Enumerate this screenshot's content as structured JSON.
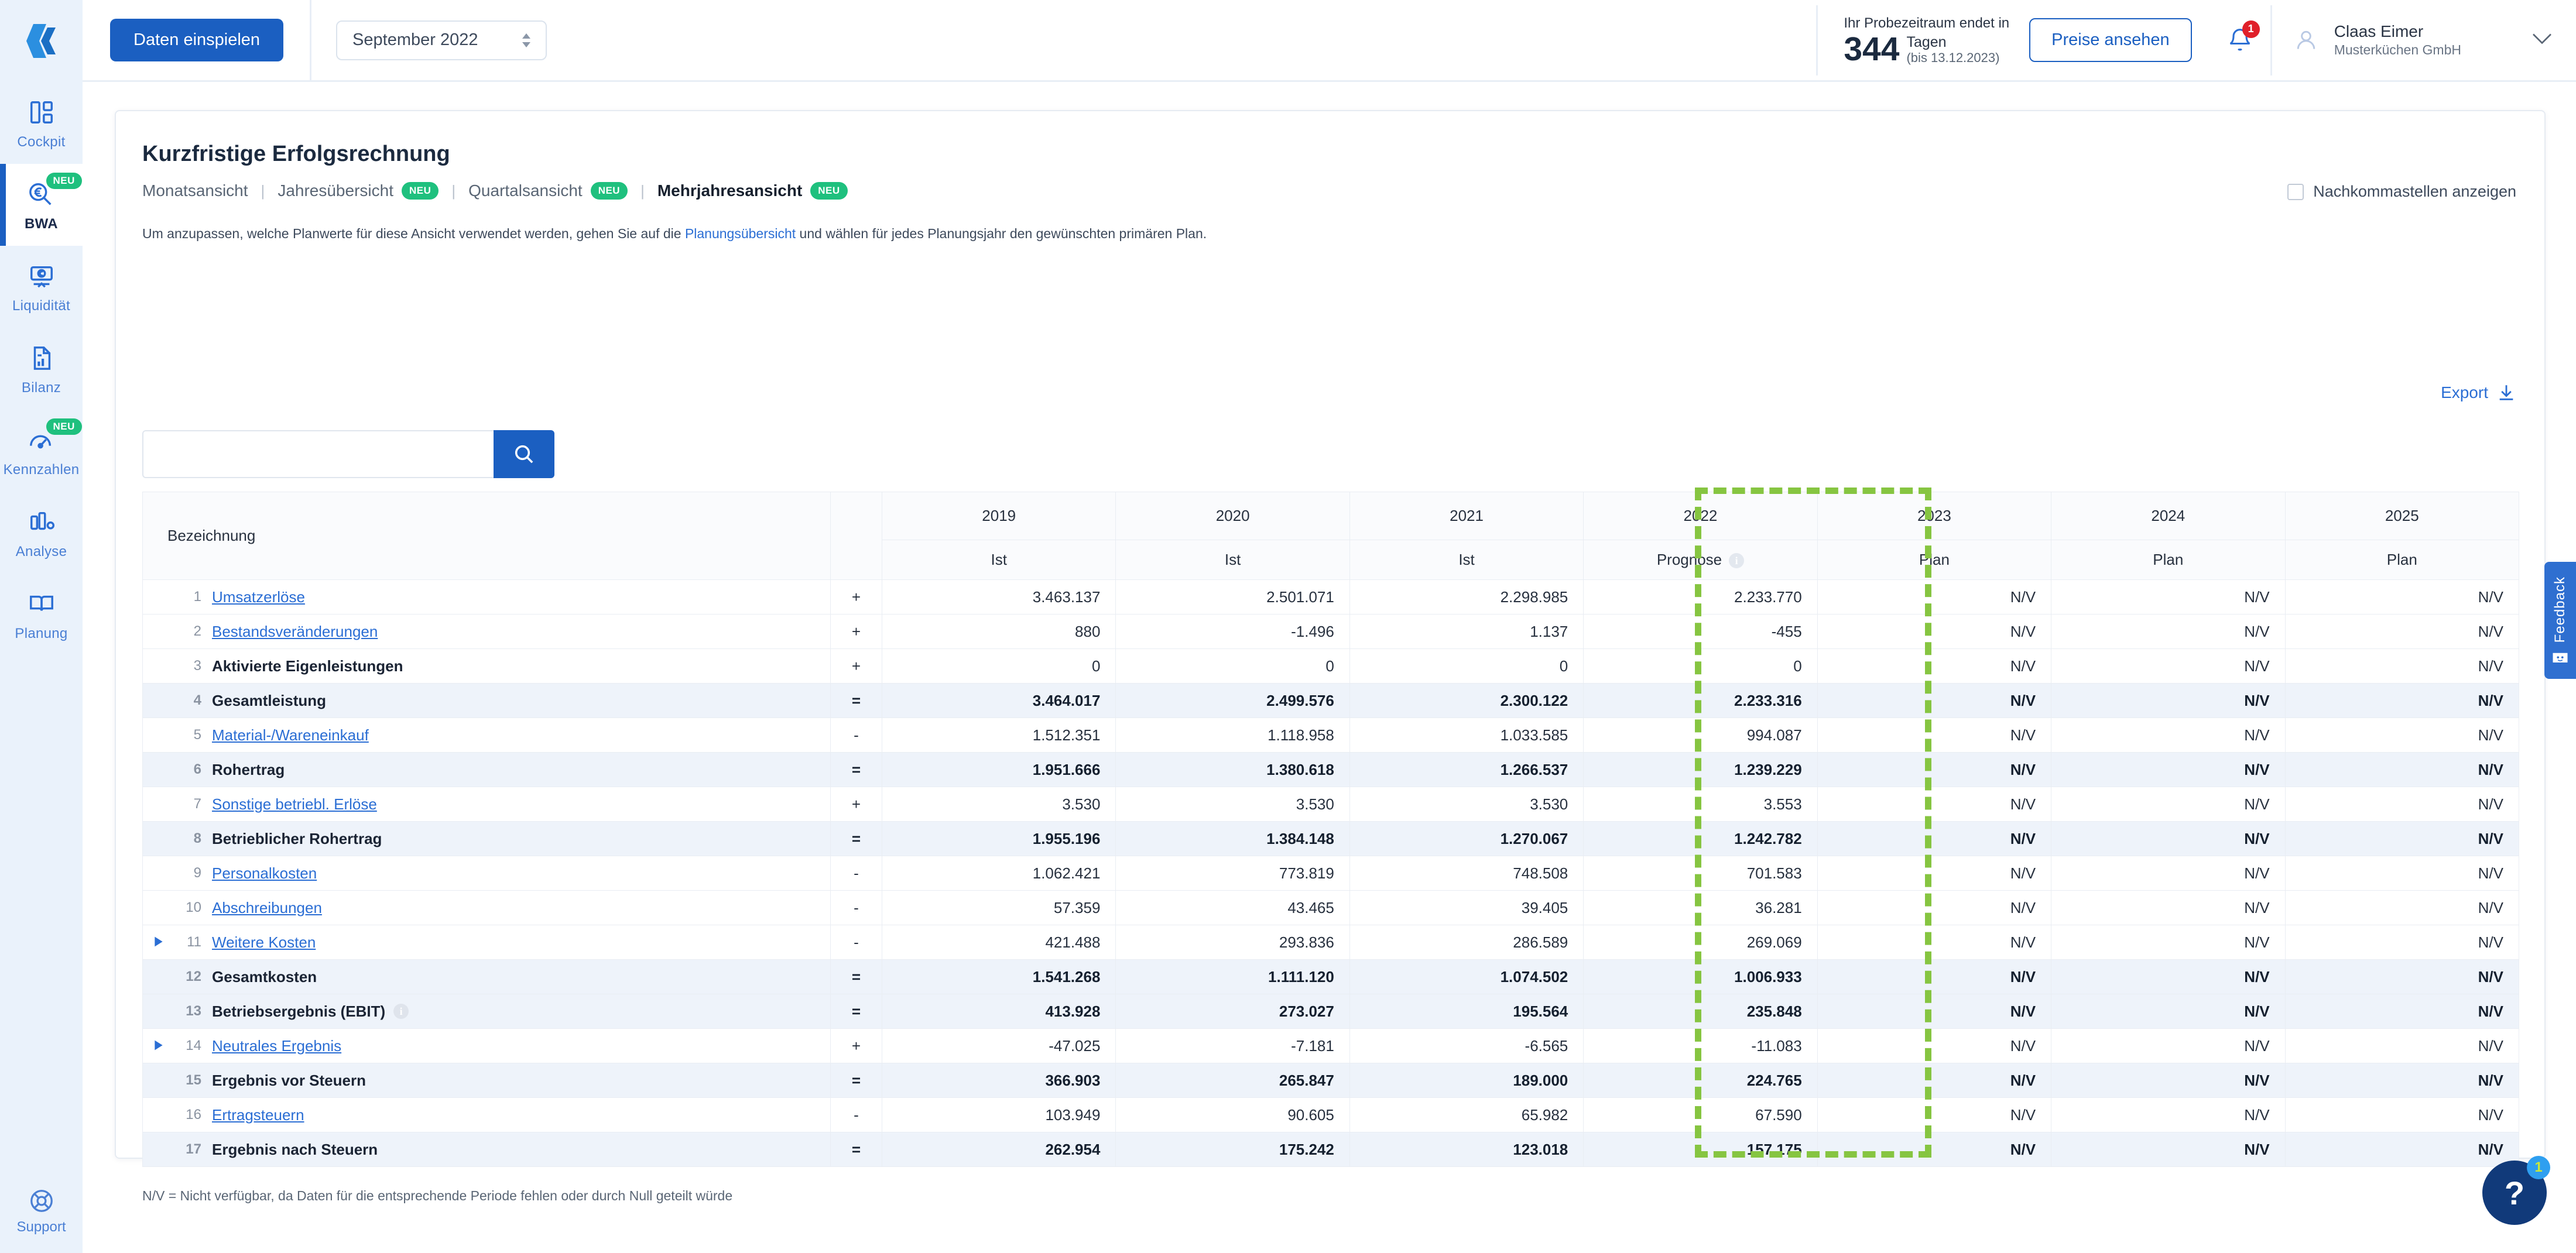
{
  "sidebar": {
    "logo": "agicap-logo",
    "items": [
      {
        "label": "Cockpit",
        "icon": "dashboard-icon",
        "badge": null,
        "active": false
      },
      {
        "label": "BWA",
        "icon": "euro-search-icon",
        "badge": "NEU",
        "active": true
      },
      {
        "label": "Liquidität",
        "icon": "cash-out-icon",
        "badge": null,
        "active": false
      },
      {
        "label": "Bilanz",
        "icon": "document-chart-icon",
        "badge": null,
        "active": false
      },
      {
        "label": "Kennzahlen",
        "icon": "gauge-icon",
        "badge": "NEU",
        "active": false
      },
      {
        "label": "Analyse",
        "icon": "bar-chart-icon",
        "badge": null,
        "active": false
      },
      {
        "label": "Planung",
        "icon": "book-icon",
        "badge": null,
        "active": false
      }
    ],
    "support": {
      "label": "Support",
      "icon": "lifebuoy-icon"
    }
  },
  "topbar": {
    "import_button": "Daten einspielen",
    "month_selector": "September 2022",
    "trial": {
      "line1": "Ihr Probezeitraum endet in",
      "days": "344",
      "days_unit": "Tagen",
      "until": "(bis 13.12.2023)"
    },
    "pricing_button": "Preise ansehen",
    "notification_count": "1",
    "user": {
      "name": "Claas Eimer",
      "org": "Musterküchen GmbH"
    }
  },
  "page": {
    "title": "Kurzfristige Erfolgsrechnung",
    "tabs": [
      {
        "label": "Monatsansicht",
        "badge": null,
        "active": false
      },
      {
        "label": "Jahresübersicht",
        "badge": "NEU",
        "active": false
      },
      {
        "label": "Quartalsansicht",
        "badge": "NEU",
        "active": false
      },
      {
        "label": "Mehrjahresansicht",
        "badge": "NEU",
        "active": true
      }
    ],
    "decimals_checkbox_label": "Nachkommastellen anzeigen",
    "hint_before": "Um anzupassen, welche Planwerte für diese Ansicht verwendet werden, gehen Sie auf die ",
    "hint_link": "Planungsübersicht",
    "hint_after": " und wählen für jedes Planungsjahr den gewünschten primären Plan.",
    "search_placeholder": "",
    "search_value": "",
    "export_label": "Export",
    "footnote": "N/V = Nicht verfügbar, da Daten für die entsprechende Periode fehlen oder durch Null geteilt würde"
  },
  "table": {
    "name_header": "Bezeichnung",
    "columns": [
      {
        "year": "2019",
        "sub": "Ist",
        "highlighted": false,
        "info": false
      },
      {
        "year": "2020",
        "sub": "Ist",
        "highlighted": false,
        "info": false
      },
      {
        "year": "2021",
        "sub": "Ist",
        "highlighted": false,
        "info": false
      },
      {
        "year": "2022",
        "sub": "Prognose",
        "highlighted": true,
        "info": true
      },
      {
        "year": "2023",
        "sub": "Plan",
        "highlighted": false,
        "info": false
      },
      {
        "year": "2024",
        "sub": "Plan",
        "highlighted": false,
        "info": false
      },
      {
        "year": "2025",
        "sub": "Plan",
        "highlighted": false,
        "info": false
      }
    ],
    "rows": [
      {
        "num": "1",
        "label": "Umsatzerlöse",
        "link": true,
        "sum": false,
        "expand": false,
        "info": false,
        "sign": "+",
        "values": [
          "3.463.137",
          "2.501.071",
          "2.298.985",
          "2.233.770",
          "N/V",
          "N/V",
          "N/V"
        ]
      },
      {
        "num": "2",
        "label": "Bestandsveränderungen",
        "link": true,
        "sum": false,
        "expand": false,
        "info": false,
        "sign": "+",
        "values": [
          "880",
          "-1.496",
          "1.137",
          "-455",
          "N/V",
          "N/V",
          "N/V"
        ]
      },
      {
        "num": "3",
        "label": "Aktivierte Eigenleistungen",
        "link": false,
        "sum": false,
        "expand": false,
        "info": false,
        "sign": "+",
        "values": [
          "0",
          "0",
          "0",
          "0",
          "N/V",
          "N/V",
          "N/V"
        ]
      },
      {
        "num": "4",
        "label": "Gesamtleistung",
        "link": false,
        "sum": true,
        "expand": false,
        "info": false,
        "sign": "=",
        "values": [
          "3.464.017",
          "2.499.576",
          "2.300.122",
          "2.233.316",
          "N/V",
          "N/V",
          "N/V"
        ]
      },
      {
        "num": "5",
        "label": "Material-/Wareneinkauf",
        "link": true,
        "sum": false,
        "expand": false,
        "info": false,
        "sign": "-",
        "values": [
          "1.512.351",
          "1.118.958",
          "1.033.585",
          "994.087",
          "N/V",
          "N/V",
          "N/V"
        ]
      },
      {
        "num": "6",
        "label": "Rohertrag",
        "link": false,
        "sum": true,
        "expand": false,
        "info": false,
        "sign": "=",
        "values": [
          "1.951.666",
          "1.380.618",
          "1.266.537",
          "1.239.229",
          "N/V",
          "N/V",
          "N/V"
        ]
      },
      {
        "num": "7",
        "label": "Sonstige betriebl. Erlöse",
        "link": true,
        "sum": false,
        "expand": false,
        "info": false,
        "sign": "+",
        "values": [
          "3.530",
          "3.530",
          "3.530",
          "3.553",
          "N/V",
          "N/V",
          "N/V"
        ]
      },
      {
        "num": "8",
        "label": "Betrieblicher Rohertrag",
        "link": false,
        "sum": true,
        "expand": false,
        "info": false,
        "sign": "=",
        "values": [
          "1.955.196",
          "1.384.148",
          "1.270.067",
          "1.242.782",
          "N/V",
          "N/V",
          "N/V"
        ]
      },
      {
        "num": "9",
        "label": "Personalkosten",
        "link": true,
        "sum": false,
        "expand": false,
        "info": false,
        "sign": "-",
        "values": [
          "1.062.421",
          "773.819",
          "748.508",
          "701.583",
          "N/V",
          "N/V",
          "N/V"
        ]
      },
      {
        "num": "10",
        "label": "Abschreibungen",
        "link": true,
        "sum": false,
        "expand": false,
        "info": false,
        "sign": "-",
        "values": [
          "57.359",
          "43.465",
          "39.405",
          "36.281",
          "N/V",
          "N/V",
          "N/V"
        ]
      },
      {
        "num": "11",
        "label": "Weitere Kosten",
        "link": true,
        "sum": false,
        "expand": true,
        "info": false,
        "sign": "-",
        "values": [
          "421.488",
          "293.836",
          "286.589",
          "269.069",
          "N/V",
          "N/V",
          "N/V"
        ]
      },
      {
        "num": "12",
        "label": "Gesamtkosten",
        "link": false,
        "sum": true,
        "expand": false,
        "info": false,
        "sign": "=",
        "values": [
          "1.541.268",
          "1.111.120",
          "1.074.502",
          "1.006.933",
          "N/V",
          "N/V",
          "N/V"
        ]
      },
      {
        "num": "13",
        "label": "Betriebsergebnis (EBIT)",
        "link": false,
        "sum": true,
        "expand": false,
        "info": true,
        "sign": "=",
        "values": [
          "413.928",
          "273.027",
          "195.564",
          "235.848",
          "N/V",
          "N/V",
          "N/V"
        ]
      },
      {
        "num": "14",
        "label": "Neutrales Ergebnis",
        "link": true,
        "sum": false,
        "expand": true,
        "info": false,
        "sign": "+",
        "values": [
          "-47.025",
          "-7.181",
          "-6.565",
          "-11.083",
          "N/V",
          "N/V",
          "N/V"
        ]
      },
      {
        "num": "15",
        "label": "Ergebnis vor Steuern",
        "link": false,
        "sum": true,
        "expand": false,
        "info": false,
        "sign": "=",
        "values": [
          "366.903",
          "265.847",
          "189.000",
          "224.765",
          "N/V",
          "N/V",
          "N/V"
        ]
      },
      {
        "num": "16",
        "label": "Ertragsteuern",
        "link": true,
        "sum": false,
        "expand": false,
        "info": false,
        "sign": "-",
        "values": [
          "103.949",
          "90.605",
          "65.982",
          "67.590",
          "N/V",
          "N/V",
          "N/V"
        ]
      },
      {
        "num": "17",
        "label": "Ergebnis nach Steuern",
        "link": false,
        "sum": true,
        "expand": false,
        "info": false,
        "sign": "=",
        "values": [
          "262.954",
          "175.242",
          "123.018",
          "157.175",
          "N/V",
          "N/V",
          "N/V"
        ]
      }
    ]
  },
  "feedback": {
    "label": "Feedback",
    "icon": "smiley-box-icon"
  },
  "help": {
    "glyph": "?",
    "badge": "1"
  },
  "colors": {
    "brand_blue": "#1b5fc1",
    "link_blue": "#2b6ed4",
    "neu_green": "#1fc07e",
    "highlight_green": "#86c541",
    "sidebar_bg": "#eaf2fb",
    "sum_row_bg": "#eef3fa",
    "badge_red": "#e0202a"
  }
}
